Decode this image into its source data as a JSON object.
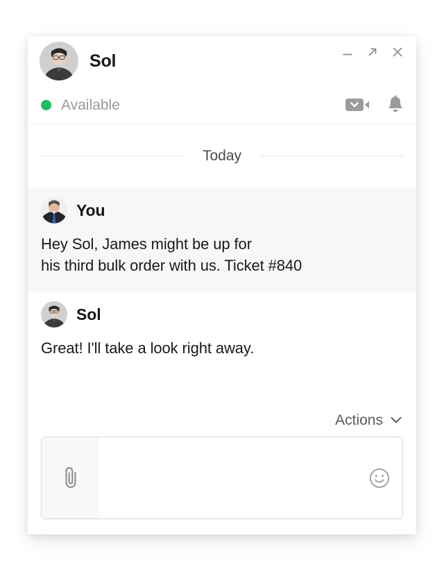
{
  "window": {
    "contact_name": "Sol",
    "status_label": "Available",
    "status_color": "#1fba62",
    "controls": {
      "minimize": "minimize-icon",
      "expand": "expand-icon",
      "close": "close-icon"
    },
    "header_actions": {
      "video_call": "video-camera-dropdown-icon",
      "notifications": "bell-icon"
    }
  },
  "conversation": {
    "day_label": "Today",
    "messages": [
      {
        "sender": "You",
        "text": "Hey Sol, James might be up for\nhis third bulk order with us. Ticket #840",
        "highlighted": true
      },
      {
        "sender": "Sol",
        "text": "Great! I'll take a look right away.",
        "highlighted": false
      }
    ]
  },
  "composer": {
    "actions_label": "Actions",
    "actions_chevron": "chevron-down-icon",
    "attach_icon": "paperclip-icon",
    "emoji_icon": "smiley-icon",
    "input_value": "",
    "input_placeholder": ""
  }
}
